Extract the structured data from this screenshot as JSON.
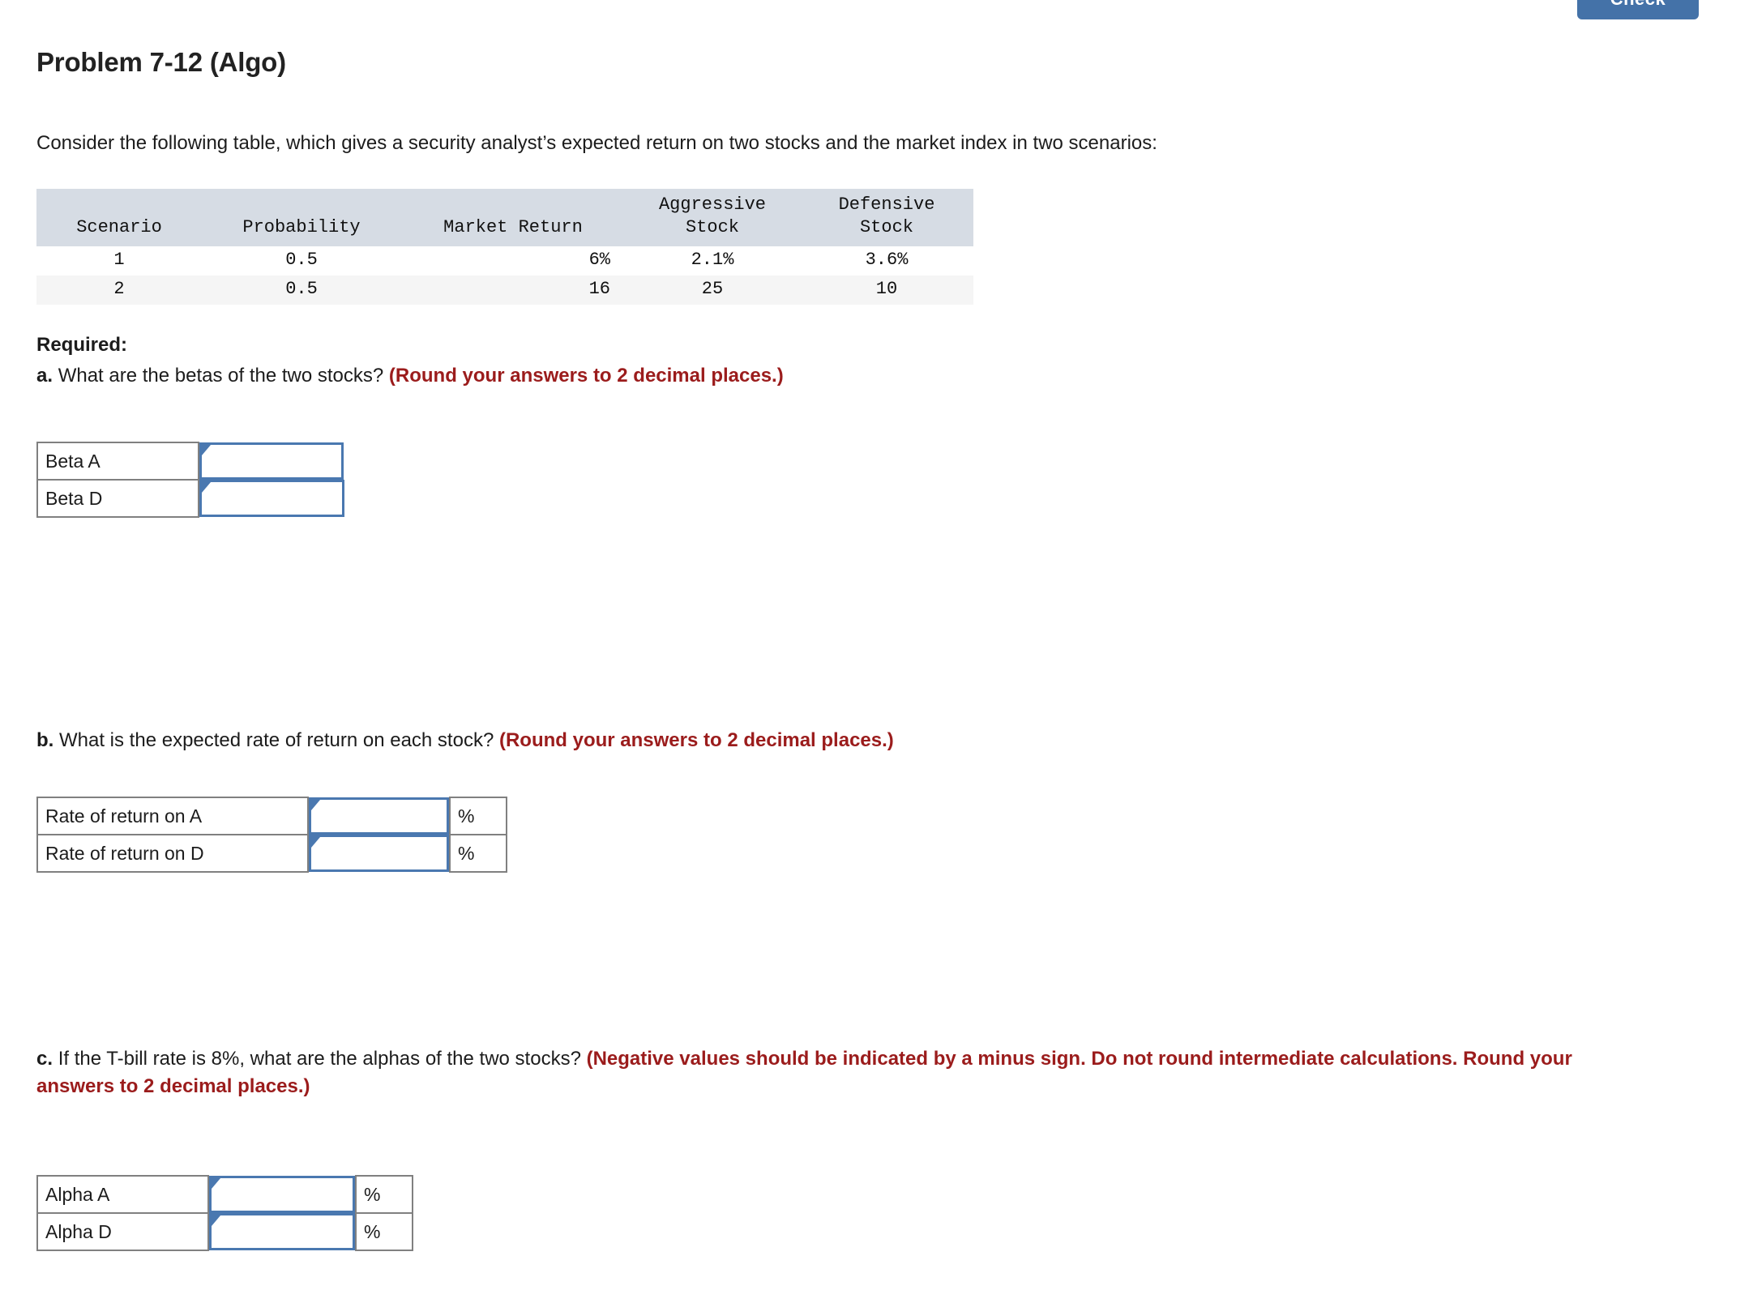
{
  "toolbar": {
    "check_label": "Check"
  },
  "header": {
    "title": "Problem 7-12 (Algo)"
  },
  "intro": {
    "text": "Consider the following table, which gives a security analyst’s expected return on two stocks and the market index in two scenarios:"
  },
  "scenario_table": {
    "columns": [
      "Scenario",
      "Probability",
      "Market Return",
      "Aggressive Stock",
      "Defensive Stock"
    ],
    "column_lines": [
      [
        "",
        "Scenario"
      ],
      [
        "",
        "Probability"
      ],
      [
        "",
        "Market Return"
      ],
      [
        "Aggressive",
        "Stock"
      ],
      [
        "Defensive",
        "Stock"
      ]
    ],
    "rows": [
      {
        "scenario": "1",
        "probability": "0.5",
        "market_return": "6%",
        "aggressive_stock": "2.1%",
        "defensive_stock": "3.6%"
      },
      {
        "scenario": "2",
        "probability": "0.5",
        "market_return": "16",
        "aggressive_stock": "25",
        "defensive_stock": "10"
      }
    ]
  },
  "required": {
    "label": "Required:"
  },
  "questions": {
    "a": {
      "letter": "a.",
      "prompt": "What are the betas of the two stocks?",
      "hint": "(Round your answers to 2 decimal places.)",
      "rows": [
        {
          "label": "Beta A",
          "value": "",
          "unit": ""
        },
        {
          "label": "Beta D",
          "value": "",
          "unit": ""
        }
      ]
    },
    "b": {
      "letter": "b.",
      "prompt": "What is the expected rate of return on each stock?",
      "hint": "(Round your answers to 2 decimal places.)",
      "rows": [
        {
          "label": "Rate of return on A",
          "value": "",
          "unit": "%"
        },
        {
          "label": "Rate of return on D",
          "value": "",
          "unit": "%"
        }
      ]
    },
    "c": {
      "letter": "c.",
      "prompt": "If the T-bill rate is 8%, what are the alphas of the two stocks?",
      "hint": "(Negative values should be indicated by a minus sign. Do not round intermediate calculations. Round your answers to 2 decimal places.)",
      "rows": [
        {
          "label": "Alpha A",
          "value": "",
          "unit": "%"
        },
        {
          "label": "Alpha D",
          "value": "",
          "unit": "%"
        }
      ]
    }
  },
  "colors": {
    "accent_blue": "#4472a8",
    "field_border_blue": "#4a78b0",
    "hint_red": "#9b1c1c",
    "table_header_bg": "#d6dce4",
    "table_alt_row_bg": "#f5f5f5"
  }
}
